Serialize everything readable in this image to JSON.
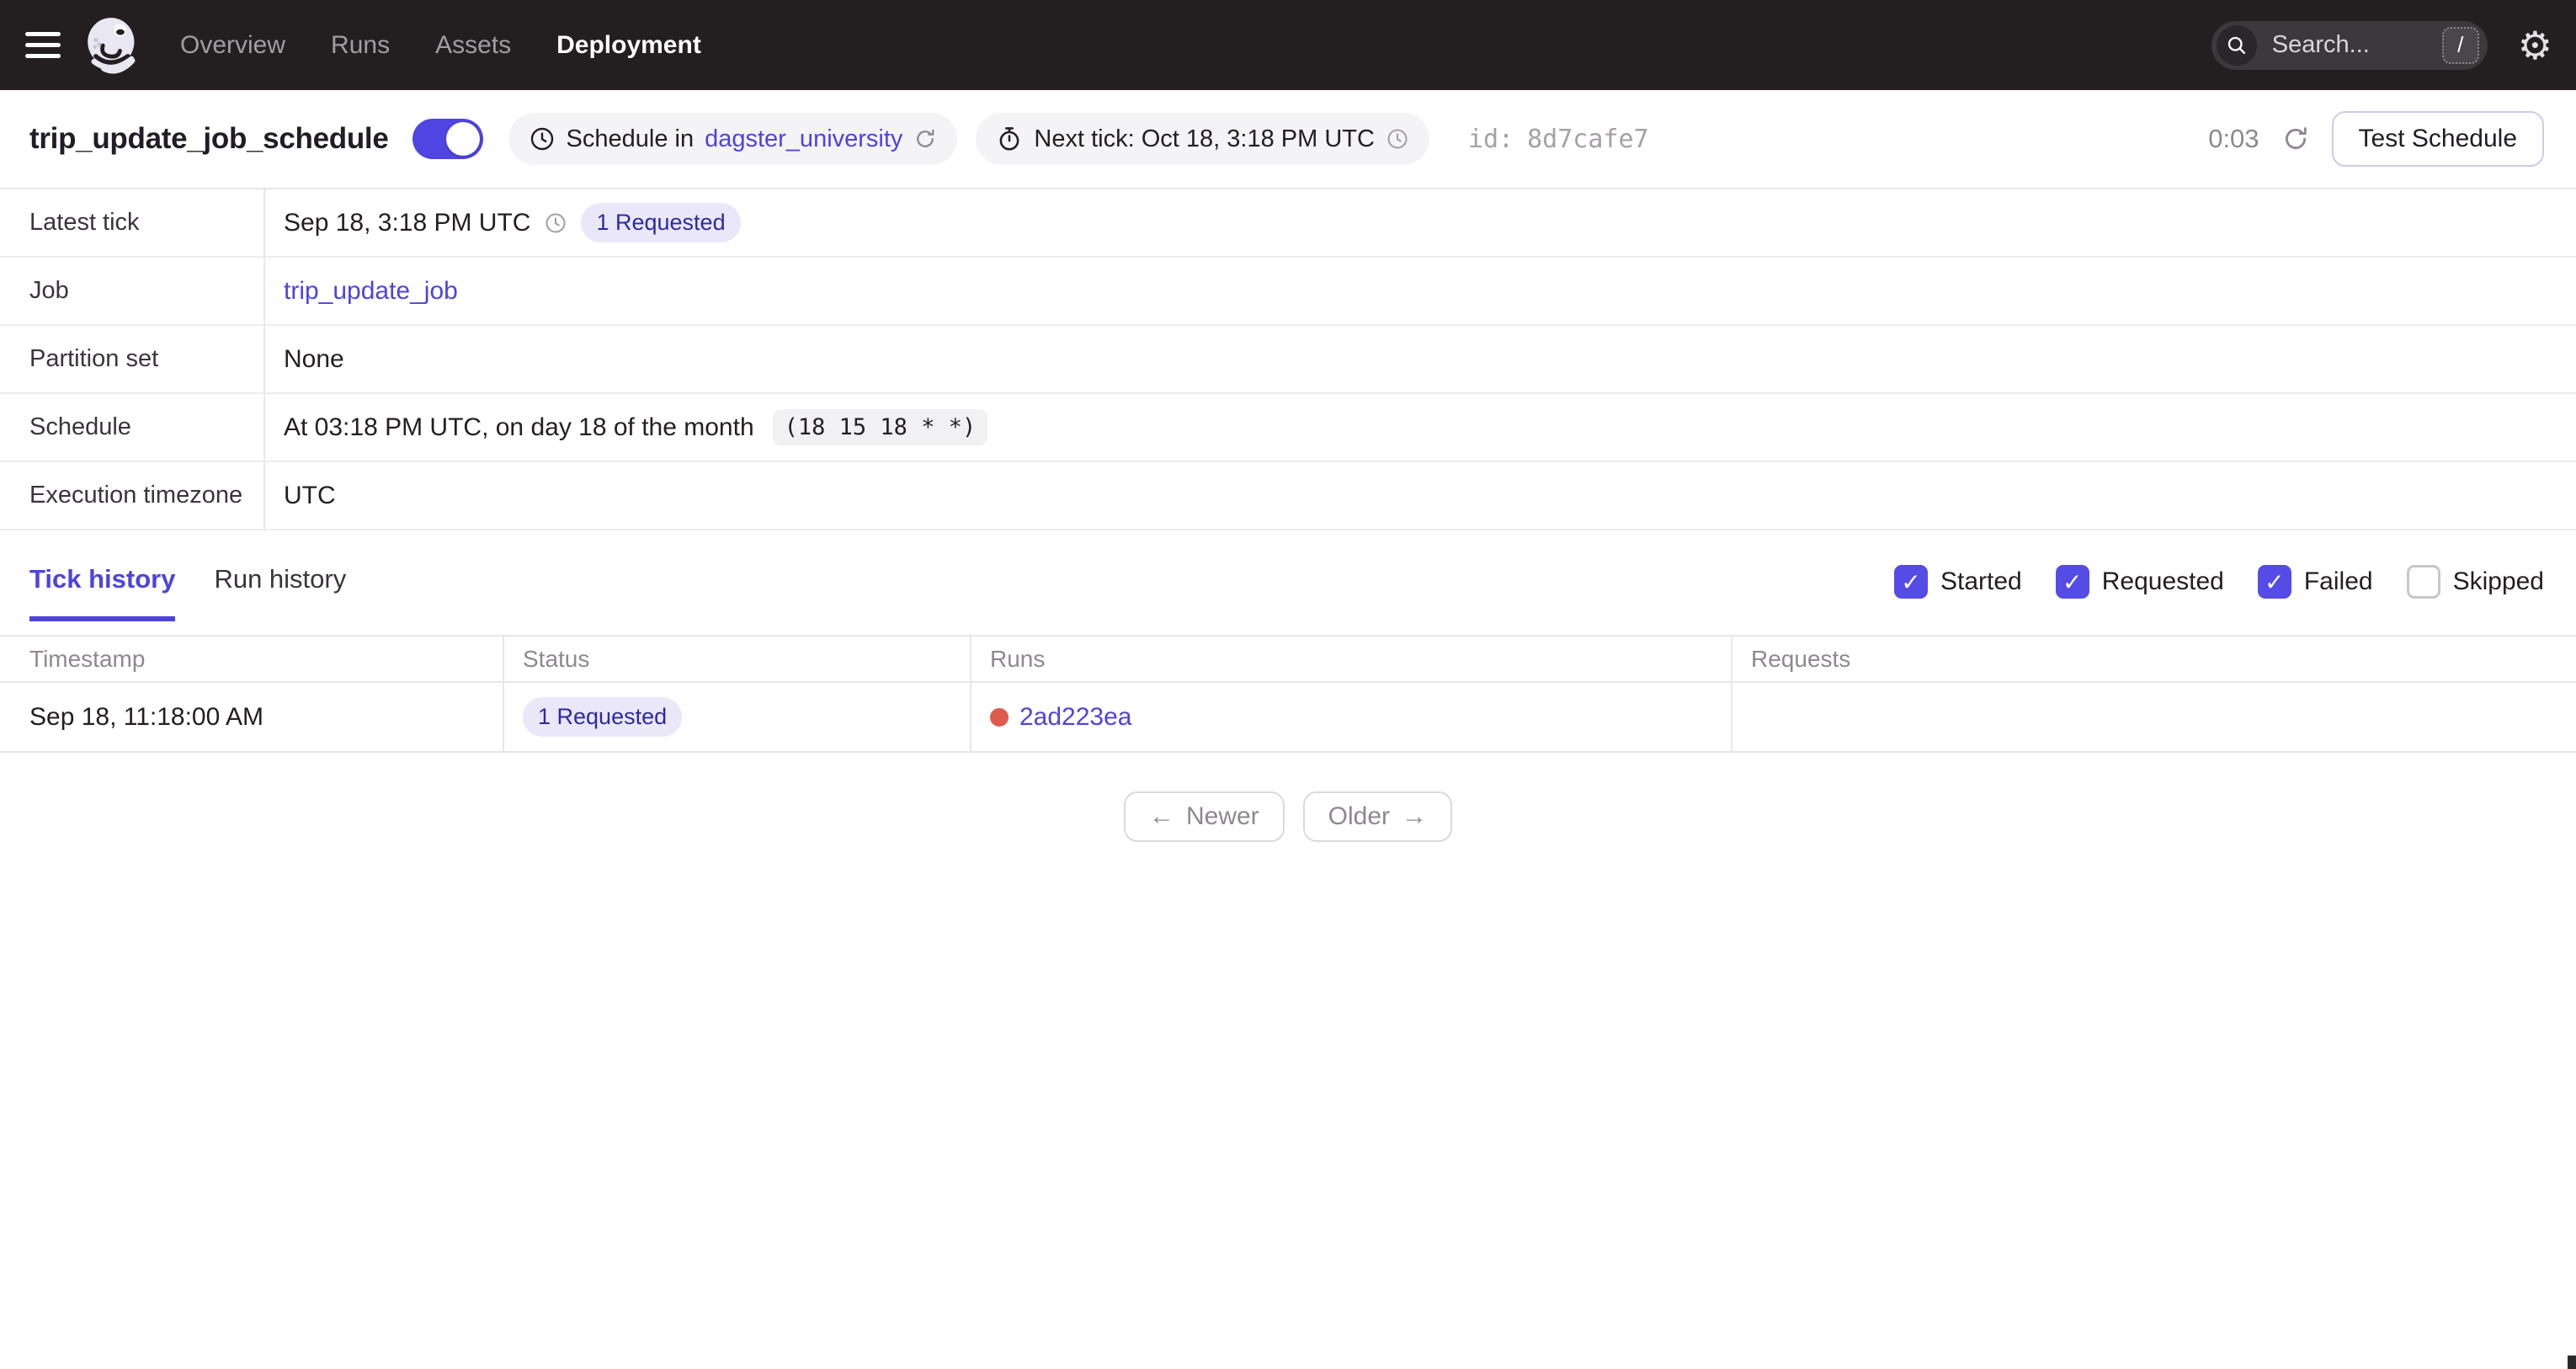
{
  "colors": {
    "nav_bg": "#231F20",
    "brand_blurple": "#4F43DD",
    "control_blurple": "#544CE4",
    "badge_bg": "#E9E7F8",
    "badge_text": "#2E2AA1",
    "run_dot_red": "#DE5B4C",
    "border": "#E8E6E9"
  },
  "icons": {
    "gear": "⚙",
    "check": "✓",
    "arrow_left": "←",
    "arrow_right": "→"
  },
  "nav": {
    "tabs": [
      {
        "label": "Overview",
        "active": false
      },
      {
        "label": "Runs",
        "active": false
      },
      {
        "label": "Assets",
        "active": false
      },
      {
        "label": "Deployment",
        "active": true
      }
    ],
    "search": {
      "placeholder": "Search...",
      "shortcut": "/"
    }
  },
  "header": {
    "title": "trip_update_job_schedule",
    "toggle_on": true,
    "schedule_pill": {
      "text": "Schedule in",
      "link": "dagster_university"
    },
    "next_tick_pill": {
      "text": "Next tick: Oct 18, 3:18 PM UTC"
    },
    "id_label": "id:",
    "id_value": "8d7cafe7",
    "countdown": "0:03",
    "test_button": "Test Schedule"
  },
  "details": {
    "rows": [
      {
        "label": "Latest tick",
        "value": "Sep 18, 3:18 PM UTC",
        "badge": "1 Requested"
      },
      {
        "label": "Job",
        "link": "trip_update_job"
      },
      {
        "label": "Partition set",
        "value": "None"
      },
      {
        "label": "Schedule",
        "value": "At 03:18 PM UTC, on day 18 of the month",
        "cron": "(18 15 18 * *)"
      },
      {
        "label": "Execution timezone",
        "value": "UTC"
      }
    ]
  },
  "history": {
    "tabs": [
      {
        "label": "Tick history",
        "active": true
      },
      {
        "label": "Run history",
        "active": false
      }
    ],
    "filters": [
      {
        "label": "Started",
        "checked": true
      },
      {
        "label": "Requested",
        "checked": true
      },
      {
        "label": "Failed",
        "checked": true
      },
      {
        "label": "Skipped",
        "checked": false
      }
    ],
    "table": {
      "headers": [
        "Timestamp",
        "Status",
        "Runs",
        "Requests"
      ],
      "rows": [
        {
          "timestamp": "Sep 18, 11:18:00 AM",
          "status_badge": "1 Requested",
          "run_id": "2ad223ea",
          "requests": ""
        }
      ]
    },
    "pagination": {
      "newer": "Newer",
      "older": "Older"
    }
  }
}
